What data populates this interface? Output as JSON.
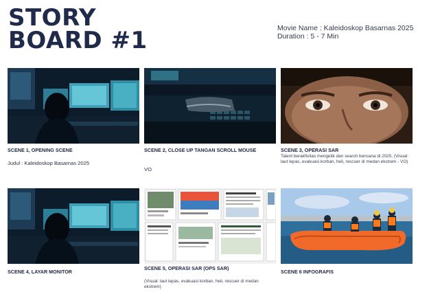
{
  "header": {
    "title_line1": "STORY",
    "title_line2": "BOARD #1",
    "movie_name": "Movie Name : Kaleidoskop Basarnas 2025",
    "duration": "Duration : 5 - 7 Min"
  },
  "scenes": [
    {
      "caption": "SCENE 1, OPENING SCENE",
      "description": "Judul : Kaleidoskop Basarnas 2025",
      "image": "hacker-at-monitors"
    },
    {
      "caption": "SCENE 2, CLOSE UP TANGAN SCROLL MOUSE",
      "description": "VO",
      "image": "hand-on-mouse"
    },
    {
      "caption": "SCENE 3, OPERASI SAR",
      "description": "Talent berakfivitas mengetik dan search bencana di 2025, (Visual: laut lepas, evakuasi korban, heli, rescuer di medan ekstrem - VO)",
      "image": "eyes-close-up"
    },
    {
      "caption": "SCENE 4, LAYAR MONITOR",
      "description": "",
      "image": "hacker-at-monitors"
    },
    {
      "caption": "SCENE 5, OPERASI SAR (OPS SAR)",
      "description": "(Visual: laut lepas, evakuasi korban, heli, rescuer di medan ekstrem)",
      "image": "news-collage"
    },
    {
      "caption": "SCENE 6 INFOGRAFIS",
      "description": "",
      "image": "rescue-boat"
    }
  ],
  "colors": {
    "title": "#202a4a",
    "screen_glow": "#5fc6d8",
    "boat_orange": "#f26a2a",
    "sky": "#9fc3e6"
  }
}
